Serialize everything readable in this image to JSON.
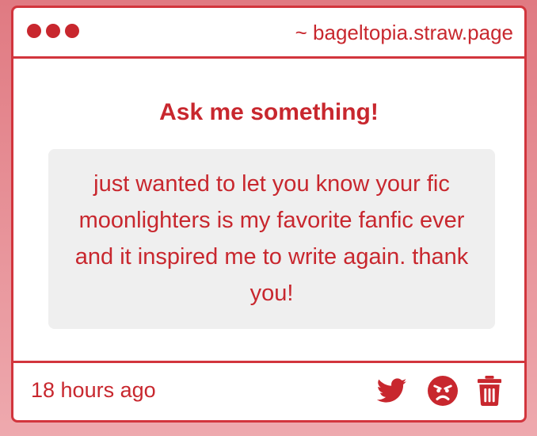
{
  "header": {
    "domain": "~ bageltopia.straw.page"
  },
  "main": {
    "title": "Ask me something!",
    "question": "just wanted to let you know your fic moonlighters is my favorite fanfic ever and it inspired me to write again. thank you!"
  },
  "footer": {
    "timestamp": "18 hours ago",
    "actions": [
      "twitter-icon",
      "angry-face-icon",
      "trash-icon"
    ]
  },
  "colors": {
    "accent": "#c8272e",
    "border": "#d2353d",
    "card_bg": "#ffffff",
    "question_bg": "#efefef",
    "page_bg_top": "#e07a82",
    "page_bg_bottom": "#eea9ae"
  }
}
